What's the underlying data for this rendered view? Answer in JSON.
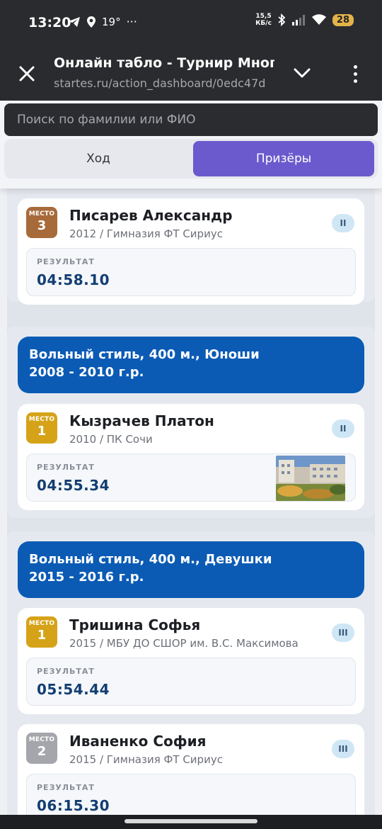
{
  "status": {
    "time": "13:20",
    "temperature": "19°",
    "more": "···",
    "speed_value": "15,5",
    "speed_unit": "КБ/с",
    "battery": "28"
  },
  "browser": {
    "title": "Онлайн табло - Турнир Многоборье",
    "url": "startes.ru/action_dashboard/0edc47d"
  },
  "search": {
    "placeholder": "Поиск по фамилии или ФИО"
  },
  "tabs": {
    "progress": "Ход",
    "winners": "Призёры"
  },
  "result_label": "РЕЗУЛЬТАТ",
  "place_label": "МЕСТО",
  "groups": [
    {
      "header": "",
      "entries": [
        {
          "place": "3",
          "medal": "bronze",
          "name": "Писарев Александр",
          "info": "2012 / Гимназия ФТ Сириус",
          "category": "II",
          "result": "04:58.10"
        }
      ]
    },
    {
      "header_line1": "Вольный стиль, 400 м., Юноши",
      "header_line2": "2008 - 2010 г.р.",
      "entries": [
        {
          "place": "1",
          "medal": "gold",
          "name": "Кызрачев Платон",
          "info": "2010 / ПК Сочи",
          "category": "II",
          "result": "04:55.34"
        }
      ]
    },
    {
      "header_line1": "Вольный стиль, 400 м., Девушки",
      "header_line2": "2015 - 2016 г.р.",
      "entries": [
        {
          "place": "1",
          "medal": "gold",
          "name": "Тришина Софья",
          "info": "2015 / МБУ ДО СШОР им. В.С. Максимова",
          "category": "III",
          "result": "05:54.44"
        },
        {
          "place": "2",
          "medal": "silver",
          "name": "Иваненко София",
          "info": "2015 / Гимназия ФТ Сириус",
          "category": "III",
          "result": "06:15.30"
        }
      ]
    }
  ]
}
